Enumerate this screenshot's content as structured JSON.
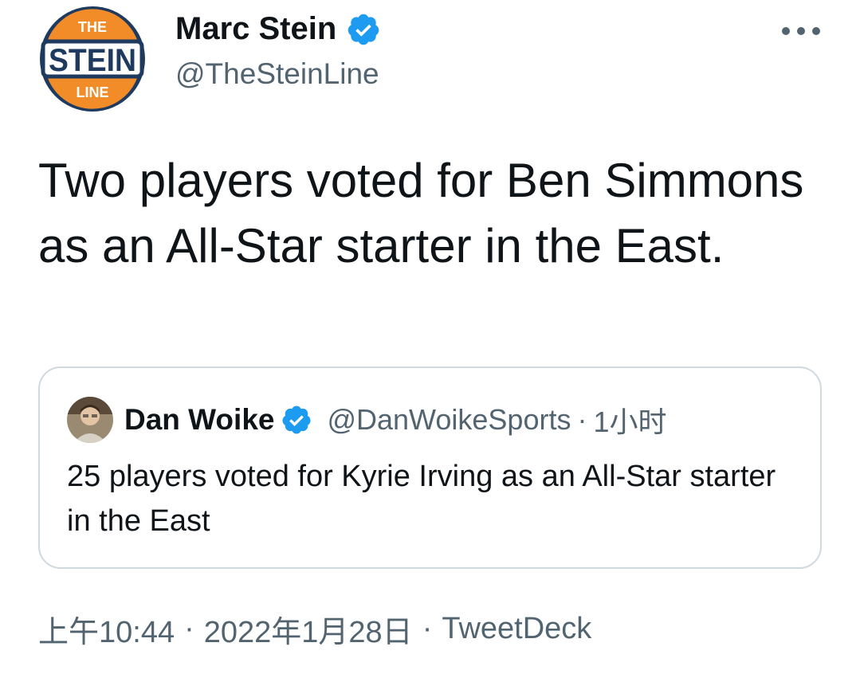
{
  "author": {
    "name": "Marc Stein",
    "handle": "@TheSteinLine",
    "avatar_logo_text": [
      "THE",
      "STEIN",
      "LINE"
    ],
    "verified": true
  },
  "tweet": {
    "text": "Two players voted for Ben Simmons as an All-Star starter in the East."
  },
  "quoted": {
    "name": "Dan Woike",
    "handle": "@DanWoikeSports",
    "separator": "·",
    "time": "1小时",
    "text": "25 players voted for Kyrie Irving as an All-Star starter in the East",
    "verified": true
  },
  "meta": {
    "time": "上午10:44",
    "date": "2022年1月28日",
    "separator": "·",
    "source": "TweetDeck"
  },
  "colors": {
    "verified_blue": "#1d9bf0",
    "secondary_text": "#536471",
    "border": "#cfd9de",
    "logo_orange": "#f28c28",
    "logo_navy": "#1f3a5f"
  },
  "icons": {
    "more": "more-horizontal-icon",
    "verified": "verified-badge-icon"
  }
}
